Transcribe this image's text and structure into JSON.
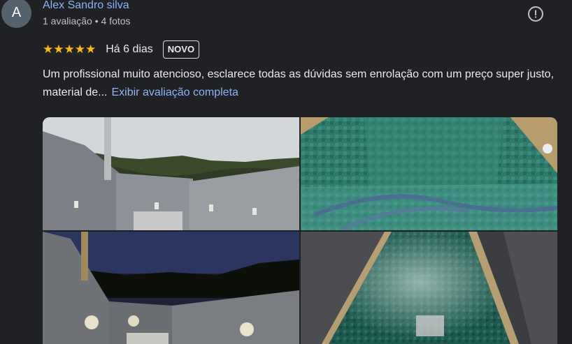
{
  "review": {
    "avatar_letter": "A",
    "author": "Alex Sandro silva",
    "meta": "1 avaliação • 4 fotos",
    "stars": "★★★★★",
    "rating": 5,
    "time_ago": "Há 6 dias",
    "badge": "NOVO",
    "text": "Um profissional muito atencioso, esclarece todas as dúvidas sem enrolação com um preço super justo, material de...",
    "more_link": "Exibir avaliação completa"
  },
  "colors": {
    "background": "#202124",
    "link": "#8ab4f8",
    "star": "#fbbc04",
    "avatar": "#54626e"
  },
  "icons": {
    "report": "report-flag-icon"
  }
}
